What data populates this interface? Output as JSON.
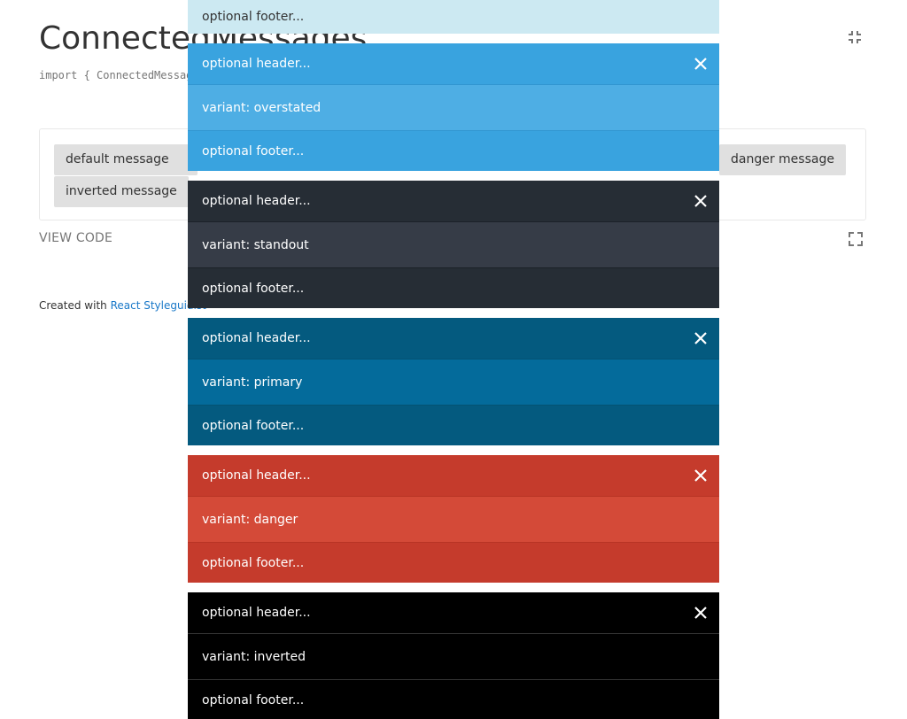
{
  "page": {
    "title": "ConnectedMessages",
    "import_line": "import { ConnectedMessag",
    "view_code": "VIEW CODE",
    "created_with_prefix": "Created with ",
    "created_with_link": "React Styleguidist"
  },
  "icons": {
    "collapse": "collapse-icon",
    "fullscreen": "fullscreen-icon",
    "close": "close-icon"
  },
  "buttons": [
    {
      "label": "default message"
    },
    {
      "label": ""
    },
    {
      "label": "danger message"
    },
    {
      "label": "inverted message"
    }
  ],
  "partial_message": {
    "footer": "optional footer..."
  },
  "messages": [
    {
      "variant": "overstated",
      "header": "optional header...",
      "body": "variant: overstated",
      "footer": "optional footer..."
    },
    {
      "variant": "standout",
      "header": "optional header...",
      "body": "variant: standout",
      "footer": "optional footer..."
    },
    {
      "variant": "primary",
      "header": "optional header...",
      "body": "variant: primary",
      "footer": "optional footer..."
    },
    {
      "variant": "danger",
      "header": "optional header...",
      "body": "variant: danger",
      "footer": "optional footer..."
    },
    {
      "variant": "inverted",
      "header": "optional header...",
      "body": "variant: inverted",
      "footer": "optional footer..."
    }
  ],
  "colors": {
    "overstated": "#39a3df",
    "standout": "#262d35",
    "primary": "#045a7f",
    "danger": "#c53b2c",
    "inverted": "#000000",
    "partial_footer": "#cce9f2",
    "link": "#1978c8"
  }
}
